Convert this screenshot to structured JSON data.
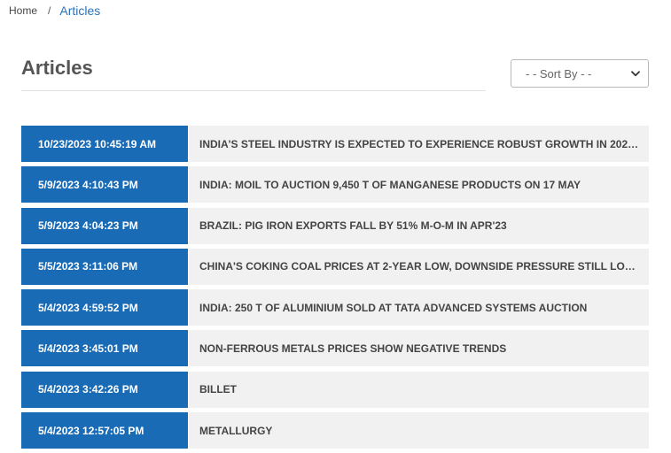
{
  "breadcrumb": {
    "home": "Home",
    "separator": "/",
    "current": "Articles"
  },
  "page": {
    "title": "Articles"
  },
  "sort": {
    "selected": "- - Sort By - -",
    "icon": "chevron-down-icon"
  },
  "articles": [
    {
      "date": "10/23/2023 10:45:19 AM",
      "title": "INDIA'S STEEL INDUSTRY IS EXPECTED TO EXPERIENCE ROBUST GROWTH IN 2023..."
    },
    {
      "date": "5/9/2023 4:10:43 PM",
      "title": "INDIA: MOIL TO AUCTION 9,450 T OF MANGANESE PRODUCTS ON 17 MAY"
    },
    {
      "date": "5/9/2023 4:04:23 PM",
      "title": "BRAZIL: PIG IRON EXPORTS FALL BY 51% M-O-M IN APR'23"
    },
    {
      "date": "5/5/2023 3:11:06 PM",
      "title": "CHINA'S COKING COAL PRICES AT 2-YEAR LOW, DOWNSIDE PRESSURE STILL LOOM..."
    },
    {
      "date": "5/4/2023 4:59:52 PM",
      "title": "INDIA: 250 T OF ALUMINIUM SOLD AT TATA ADVANCED SYSTEMS AUCTION"
    },
    {
      "date": "5/4/2023 3:45:01 PM",
      "title": "NON-FERROUS METALS PRICES SHOW NEGATIVE TRENDS"
    },
    {
      "date": "5/4/2023 3:42:26 PM",
      "title": "BILLET"
    },
    {
      "date": "5/4/2023 12:57:05 PM",
      "title": "METALLURGY"
    }
  ],
  "colors": {
    "date_bg": "#1a6bb6",
    "title_bg": "#f1f1f1",
    "link": "#2a73b8"
  }
}
